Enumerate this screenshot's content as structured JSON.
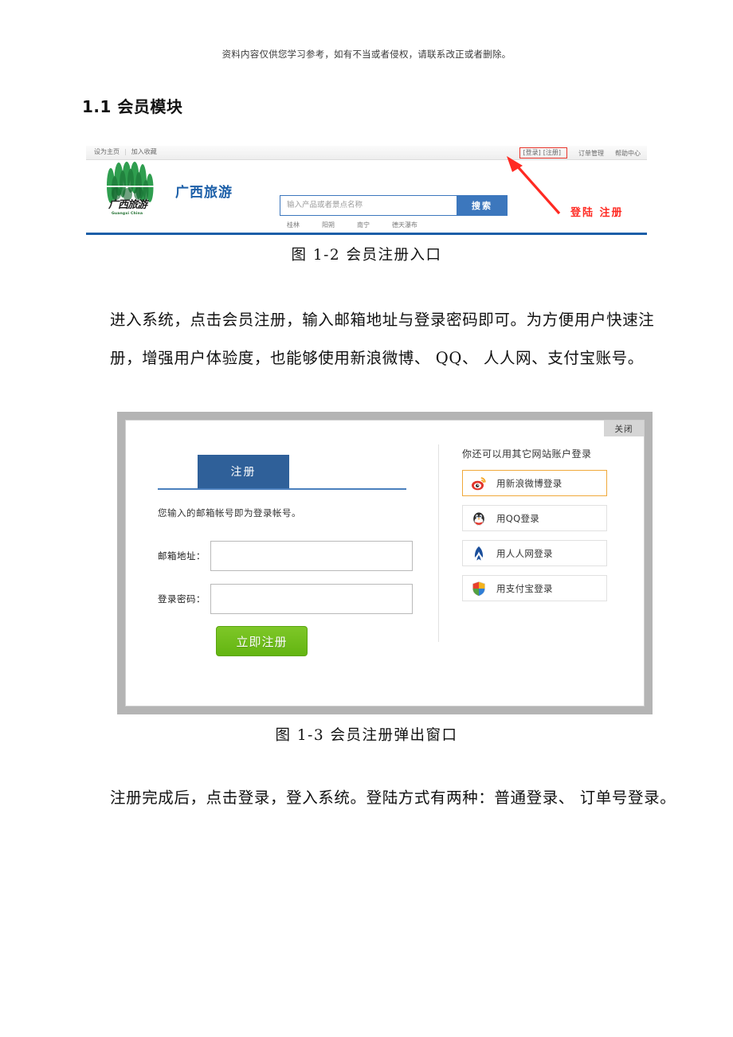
{
  "document": {
    "disclaimer": "资料内容仅供您学习参考，如有不当或者侵权，请联系改正或者删除。",
    "heading": "1.1 会员模块",
    "paragraph_1": "进入系统，点击会员注册，输入邮箱地址与登录密码即可。为方便用户快速注册，增强用户体验度，也能够使用新浪微博、 QQ、 人人网、支付宝账号。",
    "paragraph_2": "注册完成后，点击登录，登入系统。登陆方式有两种：普通登录、 订单号登录。",
    "caption_1": "图 1-2  会员注册入口",
    "caption_2": "图 1-3  会员注册弹出窗口"
  },
  "figure_header": {
    "topbar": {
      "set_home": "设为主页",
      "separator": "|",
      "add_favorite": "加入收藏",
      "login": "[登录]",
      "register": "[注册]",
      "order_manage": "订单管理",
      "help_center": "帮助中心"
    },
    "logo": {
      "cn_text": "广西旅游",
      "en_text": "Guangxi China",
      "brand": "广西旅游"
    },
    "search": {
      "placeholder": "输入产品或者景点名称",
      "value": "",
      "button": "搜索"
    },
    "hot_keywords": [
      "桂林",
      "阳朔",
      "南宁",
      "德天瀑布"
    ],
    "annotation": {
      "text": "登陆 注册",
      "color": "#ff2a22"
    },
    "colors": {
      "brand_blue": "#1c5fa8",
      "search_blue": "#3c77bd",
      "highlight_red": "#e8342a"
    }
  },
  "figure_dialog": {
    "close_label": "关闭",
    "tab_label": "注册",
    "hint": "您输入的邮箱帐号即为登录帐号。",
    "fields": [
      {
        "label": "邮箱地址：",
        "value": "",
        "name": "email"
      },
      {
        "label": "登录密码：",
        "value": "",
        "name": "password"
      }
    ],
    "submit_label": "立即注册",
    "other_login_title": "你还可以用其它网站账户登录",
    "social_buttons": [
      {
        "label": "用新浪微博登录",
        "icon": "weibo-icon",
        "active": true
      },
      {
        "label": "用QQ登录",
        "icon": "qq-icon",
        "active": false
      },
      {
        "label": "用人人网登录",
        "icon": "renren-icon",
        "active": false
      },
      {
        "label": "用支付宝登录",
        "icon": "alipay-icon",
        "active": false
      }
    ],
    "colors": {
      "tab_blue": "#2f6099",
      "submit_green": "#63b511",
      "active_border": "#f0a93b",
      "frame_gray": "#b4b4b4"
    }
  }
}
